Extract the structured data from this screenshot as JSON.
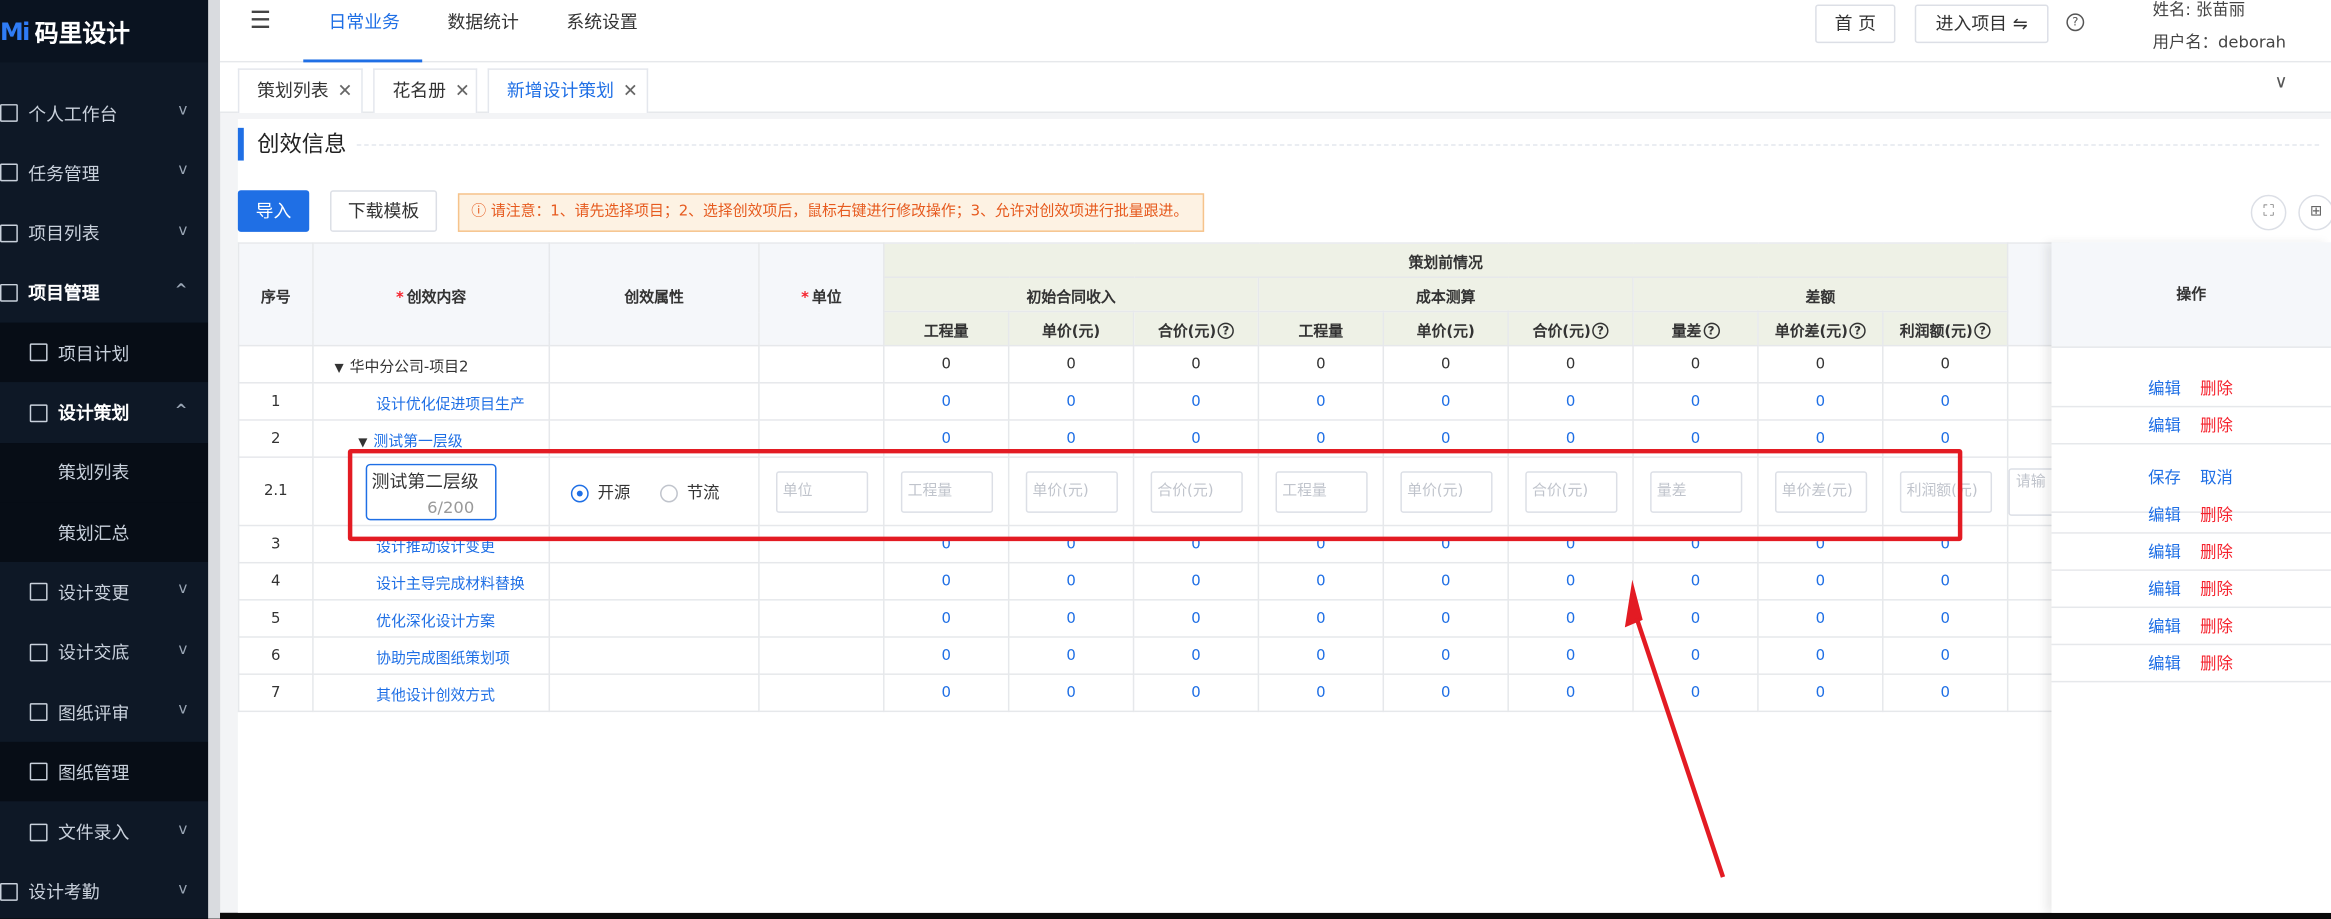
{
  "app": {
    "logo_mark": "Mi",
    "name": "码里设计"
  },
  "sidebar": {
    "items": [
      {
        "label": "个人工作台",
        "arrow": "v"
      },
      {
        "label": "任务管理",
        "arrow": "v"
      },
      {
        "label": "项目列表",
        "arrow": "v"
      },
      {
        "label": "项目管理",
        "arrow": "^"
      },
      {
        "label": "项目计划"
      },
      {
        "label": "设计策划",
        "arrow": "^"
      },
      {
        "label": "策划列表"
      },
      {
        "label": "策划汇总"
      },
      {
        "label": "设计变更",
        "arrow": "v"
      },
      {
        "label": "设计交底",
        "arrow": "v"
      },
      {
        "label": "图纸评审",
        "arrow": "v"
      },
      {
        "label": "图纸管理"
      },
      {
        "label": "文件录入",
        "arrow": "v"
      },
      {
        "label": "设计考勤",
        "arrow": "v"
      }
    ]
  },
  "topnav": {
    "items": [
      "日常业务",
      "数据统计",
      "系统设置"
    ],
    "home": "首 页",
    "enter_project": "进入项目 ⇋",
    "help": "?",
    "user_name": "姓名: 张苗丽",
    "user_login": "用户名：deborah"
  },
  "tabs": [
    {
      "label": "策划列表"
    },
    {
      "label": "花名册"
    },
    {
      "label": "新增设计策划"
    }
  ],
  "collapse": "∨",
  "section": {
    "title": "创效信息",
    "import": "导入",
    "download": "下载模板",
    "notice": "ⓘ 请注意：1、请先选择项目；2、选择创效项后，鼠标右键进行修改操作；3、允许对创效项进行批量跟进。",
    "fullscreen": "⛶",
    "settings": "⊞"
  },
  "table": {
    "headers": {
      "seq": "序号",
      "content": "创效内容",
      "attr": "创效属性",
      "unit": "单位",
      "before": "策划前情况",
      "init": "初始合同收入",
      "cost": "成本测算",
      "diff": "差额",
      "qty": "工程量",
      "price": "单价(元)",
      "total": "合价(元)",
      "diff_qty": "量差",
      "diff_price": "单价差(元)",
      "profit": "利润额(元)",
      "op": "操作",
      "req": "*"
    },
    "group_row": {
      "label": "华中分公司-项目2",
      "values": [
        "0",
        "0",
        "0",
        "0",
        "0",
        "0",
        "0",
        "0",
        "0"
      ]
    },
    "rows": [
      {
        "seq": "1",
        "name": "设计优化促进项目生产",
        "values": [
          "0",
          "0",
          "0",
          "0",
          "0",
          "0",
          "0",
          "0",
          "0"
        ]
      },
      {
        "seq": "2",
        "name": "测试第一层级",
        "values": [
          "0",
          "0",
          "0",
          "0",
          "0",
          "0",
          "0",
          "0",
          "0"
        ]
      },
      {
        "seq": "3",
        "name": "设计推动设计变更",
        "values": [
          "0",
          "0",
          "0",
          "0",
          "0",
          "0",
          "0",
          "0",
          "0"
        ]
      },
      {
        "seq": "4",
        "name": "设计主导完成材料替换",
        "values": [
          "0",
          "0",
          "0",
          "0",
          "0",
          "0",
          "0",
          "0",
          "0"
        ]
      },
      {
        "seq": "5",
        "name": "优化深化设计方案",
        "values": [
          "0",
          "0",
          "0",
          "0",
          "0",
          "0",
          "0",
          "0",
          "0"
        ]
      },
      {
        "seq": "6",
        "name": "协助完成图纸策划项",
        "values": [
          "0",
          "0",
          "0",
          "0",
          "0",
          "0",
          "0",
          "0",
          "0"
        ]
      },
      {
        "seq": "7",
        "name": "其他设计创效方式",
        "values": [
          "0",
          "0",
          "0",
          "0",
          "0",
          "0",
          "0",
          "0",
          "0"
        ]
      }
    ],
    "edit_row": {
      "seq": "2.1",
      "name_value": "测试第二层级",
      "name_count": "6/200",
      "radio_on": "开源",
      "radio_off": "节流",
      "unit_ph": "单位",
      "placeholders": [
        "工程量",
        "单价(元)",
        "合价(元)",
        "工程量",
        "单价(元)",
        "合价(元)",
        "量差",
        "单价差(元)",
        "利润额(元)"
      ],
      "extra_ph": "请输",
      "save": "保存",
      "cancel": "取消"
    },
    "ops": {
      "edit": "编辑",
      "delete": "删除"
    }
  },
  "colors": {
    "accent": "#1f6fe5",
    "danger": "#f5222d",
    "highlight": "#e31b23",
    "sidebar": "#0e1826"
  }
}
